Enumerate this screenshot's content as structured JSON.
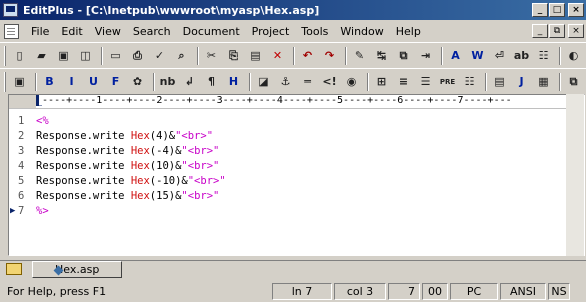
{
  "window": {
    "title": "EditPlus - [C:\\Inetpub\\wwwroot\\myasp\\Hex.asp]",
    "controls": [
      "_",
      "□",
      "×"
    ]
  },
  "menu": {
    "items": [
      "File",
      "Edit",
      "View",
      "Search",
      "Document",
      "Project",
      "Tools",
      "Window",
      "Help"
    ],
    "doc_controls": [
      "_",
      "⧉",
      "×"
    ]
  },
  "toolbar1": [
    "new-file-icon",
    "open-folder-icon",
    "save-icon",
    "save-all-icon",
    "|",
    "print-preview-icon",
    "print-icon",
    "spell-check-icon",
    "find-icon",
    "|",
    "cut-icon",
    "copy-icon",
    "paste-icon",
    "delete-icon",
    "|",
    "undo-icon",
    "redo-icon",
    "|",
    "highlight-icon",
    "replace-icon",
    "paste-special-icon",
    "indent-icon",
    "|",
    "font-icon",
    "word-wrap-icon",
    "line-break-icon",
    "abcd-icon",
    "sort-icon",
    "|",
    "browser-icon",
    "grid-icon"
  ],
  "toolbar2": [
    {
      "icon": "quick-toolbar-icon",
      "glyph": "▣"
    },
    {
      "sep": true
    },
    {
      "icon": "bold-icon",
      "glyph": "B"
    },
    {
      "icon": "italic-icon",
      "glyph": "I"
    },
    {
      "icon": "underline-icon",
      "glyph": "U"
    },
    {
      "icon": "font-face-icon",
      "glyph": "F"
    },
    {
      "icon": "color-icon",
      "glyph": "✿"
    },
    {
      "sep": true
    },
    {
      "icon": "nbsp-icon",
      "glyph": "nb"
    },
    {
      "icon": "paragraph-break-icon",
      "glyph": "↲"
    },
    {
      "icon": "pilcrow-icon",
      "glyph": "¶"
    },
    {
      "icon": "heading-icon",
      "glyph": "H"
    },
    {
      "sep": true
    },
    {
      "icon": "image-icon",
      "glyph": "◪"
    },
    {
      "icon": "anchor-icon",
      "glyph": "⚓"
    },
    {
      "icon": "horizontal-rule-icon",
      "glyph": "═"
    },
    {
      "icon": "comment-icon",
      "glyph": "<!"
    },
    {
      "icon": "circle-icon",
      "glyph": "◉"
    },
    {
      "sep": true
    },
    {
      "icon": "table-icon",
      "glyph": "⊞"
    },
    {
      "icon": "align-center-icon",
      "glyph": "≡"
    },
    {
      "icon": "align-justify-icon",
      "glyph": "☰"
    },
    {
      "icon": "pre-icon",
      "glyph": "PRE"
    },
    {
      "icon": "list-icon",
      "glyph": "☷"
    },
    {
      "sep": true
    },
    {
      "icon": "notes-icon",
      "glyph": "▤"
    },
    {
      "icon": "java-icon",
      "glyph": "J"
    },
    {
      "icon": "script-icon",
      "glyph": "▦"
    },
    {
      "sep": true
    },
    {
      "icon": "extra-icon",
      "glyph": "⧉"
    }
  ],
  "ruler": "----+----1----+----2----+----3----+----4----+----5----+----6----+----7----+---",
  "code_lines": [
    {
      "num": "1",
      "arrow": false,
      "parts": [
        {
          "t": "<%",
          "c": "tag"
        }
      ]
    },
    {
      "num": "2",
      "arrow": false,
      "parts": [
        {
          "t": "Response.write ",
          "c": "kw"
        },
        {
          "t": "Hex",
          "c": "fn"
        },
        {
          "t": "(4)",
          "c": "kw"
        },
        {
          "t": "&",
          "c": "kw"
        },
        {
          "t": "\"<br>\"",
          "c": "str"
        }
      ]
    },
    {
      "num": "3",
      "arrow": false,
      "parts": [
        {
          "t": "Response.write ",
          "c": "kw"
        },
        {
          "t": "Hex",
          "c": "fn"
        },
        {
          "t": "(-4)",
          "c": "kw"
        },
        {
          "t": "&",
          "c": "kw"
        },
        {
          "t": "\"<br>\"",
          "c": "str"
        }
      ]
    },
    {
      "num": "4",
      "arrow": false,
      "parts": [
        {
          "t": "Response.write ",
          "c": "kw"
        },
        {
          "t": "Hex",
          "c": "fn"
        },
        {
          "t": "(10)",
          "c": "kw"
        },
        {
          "t": "&",
          "c": "kw"
        },
        {
          "t": "\"<br>\"",
          "c": "str"
        }
      ]
    },
    {
      "num": "5",
      "arrow": false,
      "parts": [
        {
          "t": "Response.write ",
          "c": "kw"
        },
        {
          "t": "Hex",
          "c": "fn"
        },
        {
          "t": "(-10)",
          "c": "kw"
        },
        {
          "t": "&",
          "c": "kw"
        },
        {
          "t": "\"<br>\"",
          "c": "str"
        }
      ]
    },
    {
      "num": "6",
      "arrow": false,
      "parts": [
        {
          "t": "Response.write ",
          "c": "kw"
        },
        {
          "t": "Hex",
          "c": "fn"
        },
        {
          "t": "(15)",
          "c": "kw"
        },
        {
          "t": "&",
          "c": "kw"
        },
        {
          "t": "\"<br>\"",
          "c": "str"
        }
      ]
    },
    {
      "num": "7",
      "arrow": true,
      "parts": [
        {
          "t": "%>",
          "c": "tag"
        }
      ]
    }
  ],
  "file_tab": {
    "label": "Hex.asp"
  },
  "status": {
    "help": "For Help, press F1",
    "line": "ln 7",
    "col": "col 3",
    "count": "7",
    "code": "00",
    "eol": "PC",
    "encoding": "ANSI",
    "mode": "NS"
  },
  "colors": {
    "title_start": "#0a246a",
    "title_end": "#3a6ea5",
    "function": "#d01010",
    "string": "#c800c8"
  }
}
